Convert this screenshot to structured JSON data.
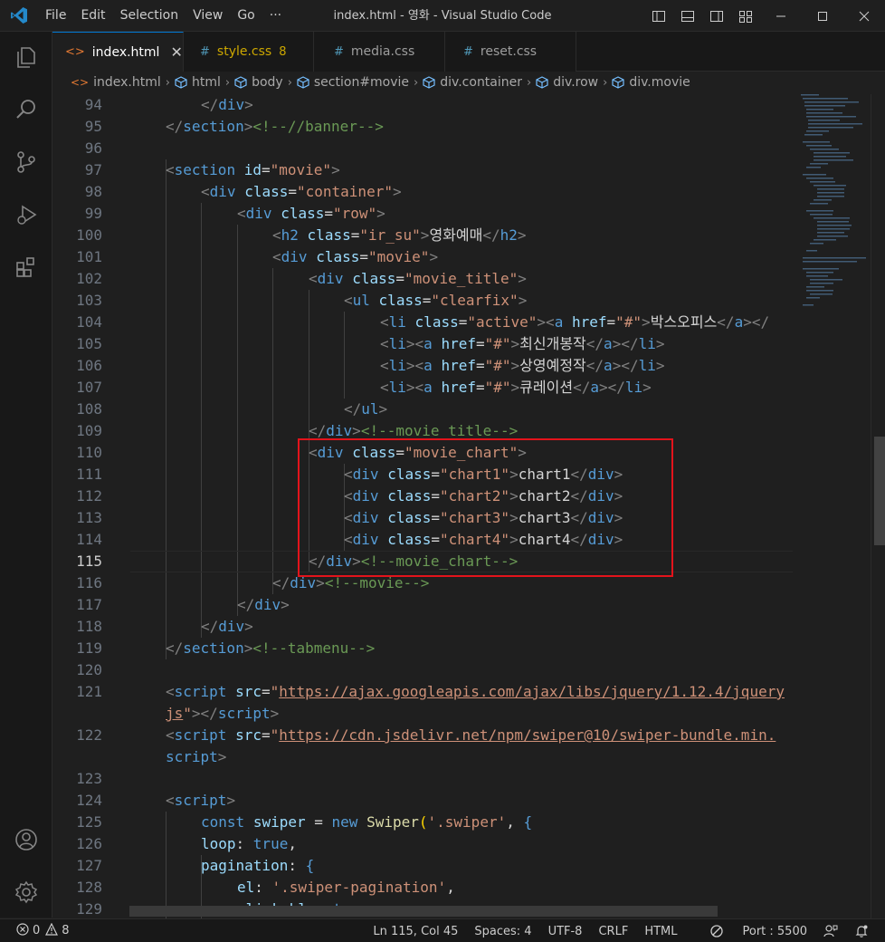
{
  "window": {
    "title": "index.html - 영화 - Visual Studio Code",
    "menu": [
      "File",
      "Edit",
      "Selection",
      "View",
      "Go",
      "···"
    ]
  },
  "tabs": [
    {
      "label": "index.html",
      "icon": "html-file-icon",
      "active": true
    },
    {
      "label": "style.css",
      "icon": "css-file-icon",
      "badge": "8",
      "active": false
    },
    {
      "label": "media.css",
      "icon": "css-file-icon",
      "active": false
    },
    {
      "label": "reset.css",
      "icon": "css-file-icon",
      "active": false
    }
  ],
  "breadcrumb": [
    "index.html",
    "html",
    "body",
    "section#movie",
    "div.container",
    "div.row",
    "div.movie"
  ],
  "editor": {
    "line_numbers": [
      "94",
      "95",
      "96",
      "97",
      "98",
      "99",
      "100",
      "101",
      "102",
      "103",
      "104",
      "105",
      "106",
      "107",
      "108",
      "109",
      "110",
      "111",
      "112",
      "113",
      "114",
      "115",
      "116",
      "117",
      "118",
      "119",
      "120",
      "121",
      "",
      "122",
      "",
      "123",
      "124",
      "125",
      "126",
      "127",
      "128",
      "129"
    ],
    "current_line": "115",
    "lines": {
      "l94": "</div>",
      "l95a": "</section>",
      "l95b": "<!--//banner-->",
      "l97": "section",
      "l97id": "id",
      "l97v": "\"movie\"",
      "l98v": "\"container\"",
      "l99v": "\"row\"",
      "l100v": "\"ir_su\"",
      "l100t": "영화예매",
      "l101v": "\"movie\"",
      "l102v": "\"movie_title\"",
      "l103v": "\"clearfix\"",
      "l104v": "\"active\"",
      "l104h": "\"#\"",
      "l104t": "박스오피스",
      "l105t": "최신개봉작",
      "l106t": "상영예정작",
      "l107t": "큐레이션",
      "l109c": "<!--movie_title-->",
      "l110v": "\"movie_chart\"",
      "l111v": "\"chart1\"",
      "l111t": "chart1",
      "l112v": "\"chart2\"",
      "l112t": "chart2",
      "l113v": "\"chart3\"",
      "l113t": "chart3",
      "l114v": "\"chart4\"",
      "l114t": "chart4",
      "l115c": "<!--movie_chart-->",
      "l116c": "<!--movie-->",
      "l119c": "<!--tabmenu-->",
      "l121u": "https://ajax.googleapis.com/ajax/libs/jquery/1.12.4/jquery",
      "l121w": "js",
      "l122u": "https://cdn.jsdelivr.net/npm/swiper@10/swiper-bundle.min.",
      "l122w": "script",
      "l125s": "'.swiper'",
      "l128s": "'.swiper-pagination'"
    }
  },
  "statusbar": {
    "errors": "0",
    "warnings": "8",
    "position": "Ln 115, Col 45",
    "spaces": "Spaces: 4",
    "encoding": "UTF-8",
    "eol": "CRLF",
    "language": "HTML",
    "port": "Port : 5500"
  },
  "colors": {
    "accent": "#0078d4",
    "highlight": "#e3131b",
    "badge": "#cca700"
  }
}
